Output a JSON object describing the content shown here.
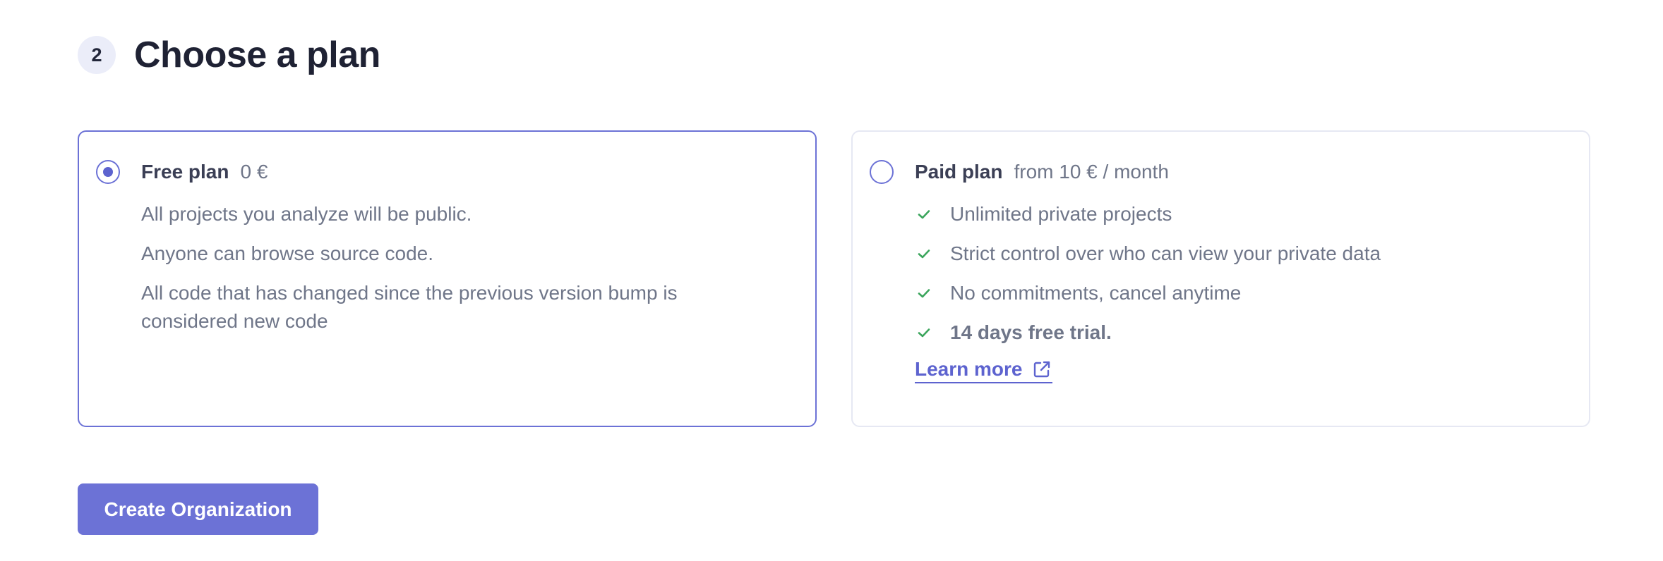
{
  "step": {
    "number": "2",
    "title": "Choose a plan"
  },
  "plans": {
    "free": {
      "selected": true,
      "name": "Free plan",
      "price": "0 €",
      "descriptions": [
        "All projects you analyze will be public.",
        "Anyone can browse source code.",
        "All code that has changed since the previous version bump is considered new code"
      ]
    },
    "paid": {
      "selected": false,
      "name": "Paid plan",
      "price": "from 10 € / month",
      "features": [
        "Unlimited private projects",
        "Strict control over who can view your private data",
        "No commitments, cancel anytime",
        "14 days free trial."
      ],
      "learn_more": "Learn more"
    }
  },
  "actions": {
    "create_label": "Create Organization"
  },
  "colors": {
    "accent": "#6c72d6",
    "check": "#3ba55c",
    "text_muted": "#6f7689",
    "border": "#e6e8f3"
  },
  "icons": {
    "feature_check": "check-icon",
    "learn_more": "external-link-icon"
  }
}
